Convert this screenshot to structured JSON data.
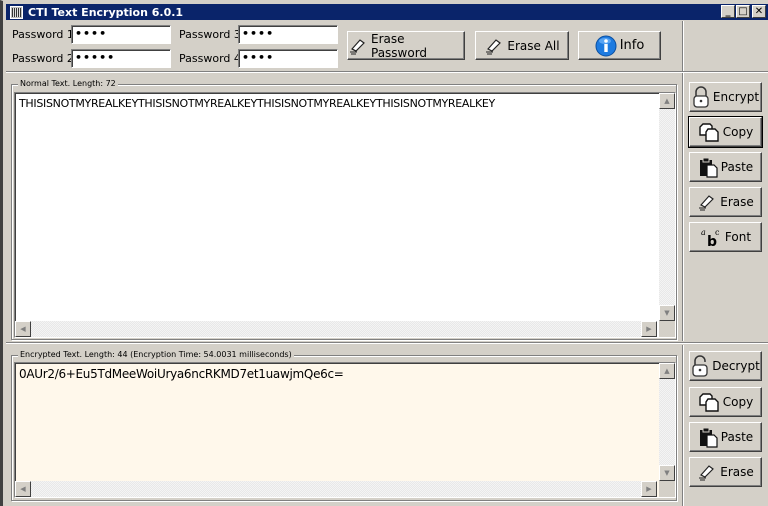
{
  "window": {
    "title": "CTI Text Encryption 6.0.1",
    "controls": {
      "minimize": "_",
      "maximize": "□",
      "close": "✕"
    }
  },
  "passwords": [
    {
      "label": "Password 1",
      "value": "••••"
    },
    {
      "label": "Password 2",
      "value": "•••••"
    },
    {
      "label": "Password 3",
      "value": "••••"
    },
    {
      "label": "Password 4",
      "value": "••••"
    }
  ],
  "toolbar": {
    "erase_password": {
      "label": "Erase Password",
      "icon": "eraser-icon"
    },
    "erase_all": {
      "label": "Erase All",
      "icon": "eraser-icon"
    },
    "info": {
      "label": "Info",
      "icon": "info-icon"
    }
  },
  "normal": {
    "group_label": "Normal Text. Length: 72",
    "text": "THISISNOTMYREALKEYTHISISNOTMYREALKEYTHISISNOTMYREALKEYTHISISNOTMYREALKEY",
    "buttons": [
      {
        "label": "Encrypt",
        "icon": "lock-icon"
      },
      {
        "label": "Copy",
        "icon": "copy-icon"
      },
      {
        "label": "Paste",
        "icon": "paste-icon"
      },
      {
        "label": "Erase",
        "icon": "eraser-icon"
      },
      {
        "label": "Font",
        "icon": "font-icon"
      }
    ]
  },
  "encrypted": {
    "group_label": "Encrypted Text. Length: 44 (Encryption Time: 54.0031 milliseconds)",
    "text": "0AUr2/6+Eu5TdMeeWoiUrya6ncRKMD7et1uawjmQe6c=",
    "buttons": [
      {
        "label": "Decrypt",
        "icon": "unlock-icon"
      },
      {
        "label": "Copy",
        "icon": "copy-icon"
      },
      {
        "label": "Paste",
        "icon": "paste-icon"
      },
      {
        "label": "Erase",
        "icon": "eraser-icon"
      }
    ]
  },
  "colors": {
    "titlebar": "#0a246a",
    "face": "#d4d0c8",
    "normal_bg": "#ffffff",
    "encrypted_bg": "#fff8eb",
    "info_blue": "#1e7be0"
  },
  "scroll_arrows": {
    "up": "▲",
    "down": "▼",
    "left": "◀",
    "right": "▶"
  }
}
